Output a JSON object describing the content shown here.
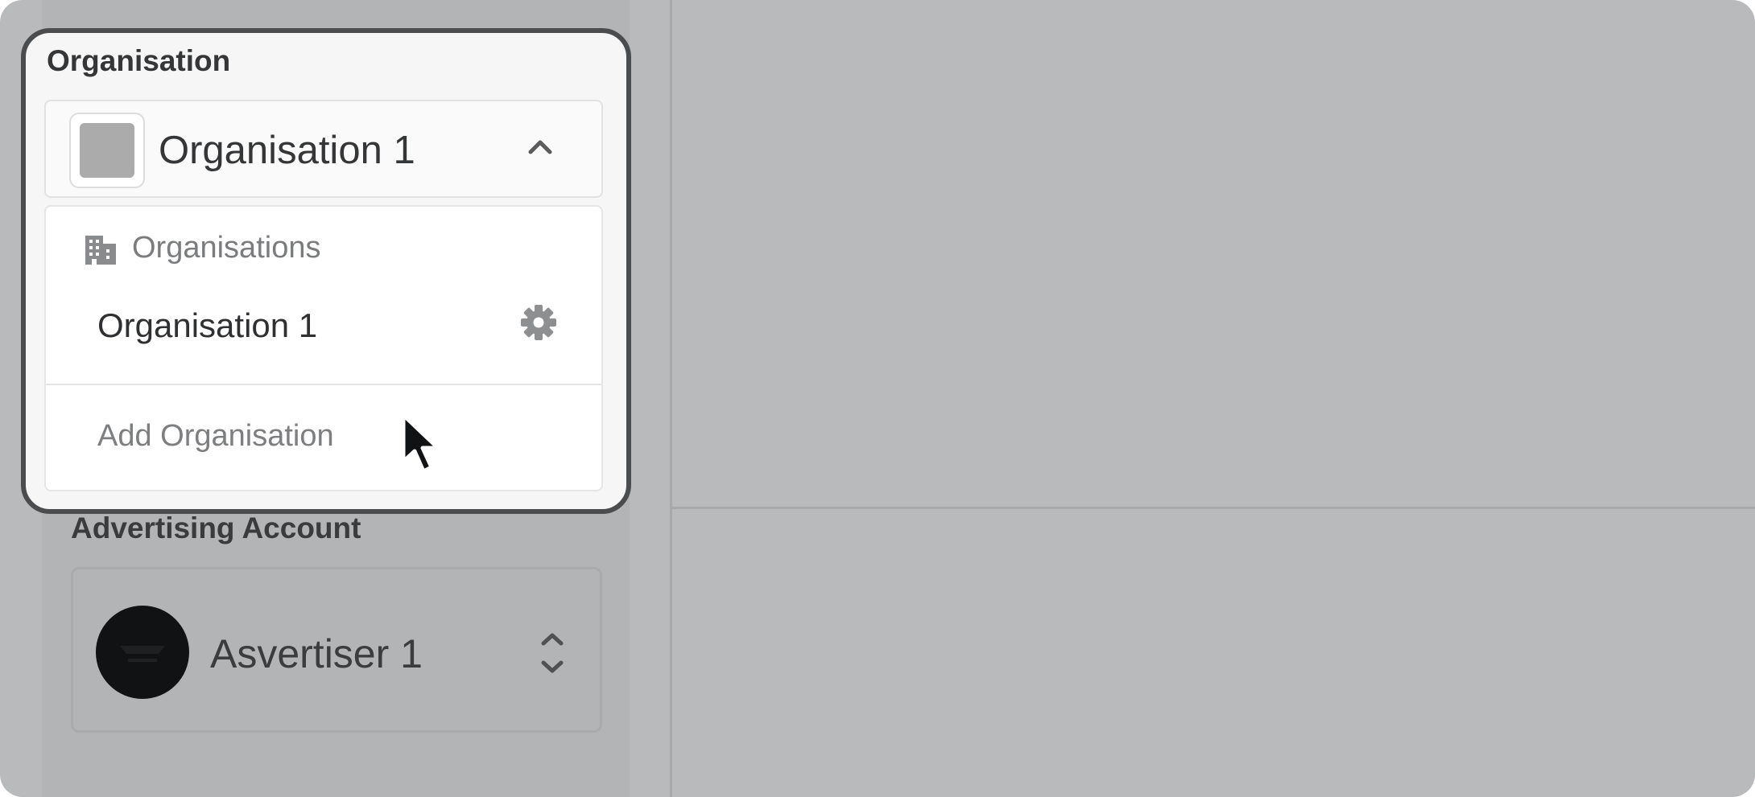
{
  "colors": {
    "backdrop": "#b9babc",
    "popup_border": "#4b4c4e",
    "text_dark": "#353638",
    "text_muted": "#7b7c7e"
  },
  "organisation": {
    "section_title": "Organisation",
    "selected": "Organisation 1",
    "selected_logo_icon": "placeholder-logo-icon",
    "toggle_icon": "chevron-up-icon"
  },
  "menu": {
    "header_icon": "building-icon",
    "header": "Organisations",
    "items": [
      {
        "label": "Organisation 1",
        "icon": "gear-icon"
      }
    ],
    "add_label": "Add Organisation"
  },
  "advertising": {
    "section_title": "Advertising Account",
    "selected": "Asvertiser 1",
    "avatar_icon": "advertiser-avatar-icon",
    "toggle_icon": "chevron-up-down-icon"
  }
}
